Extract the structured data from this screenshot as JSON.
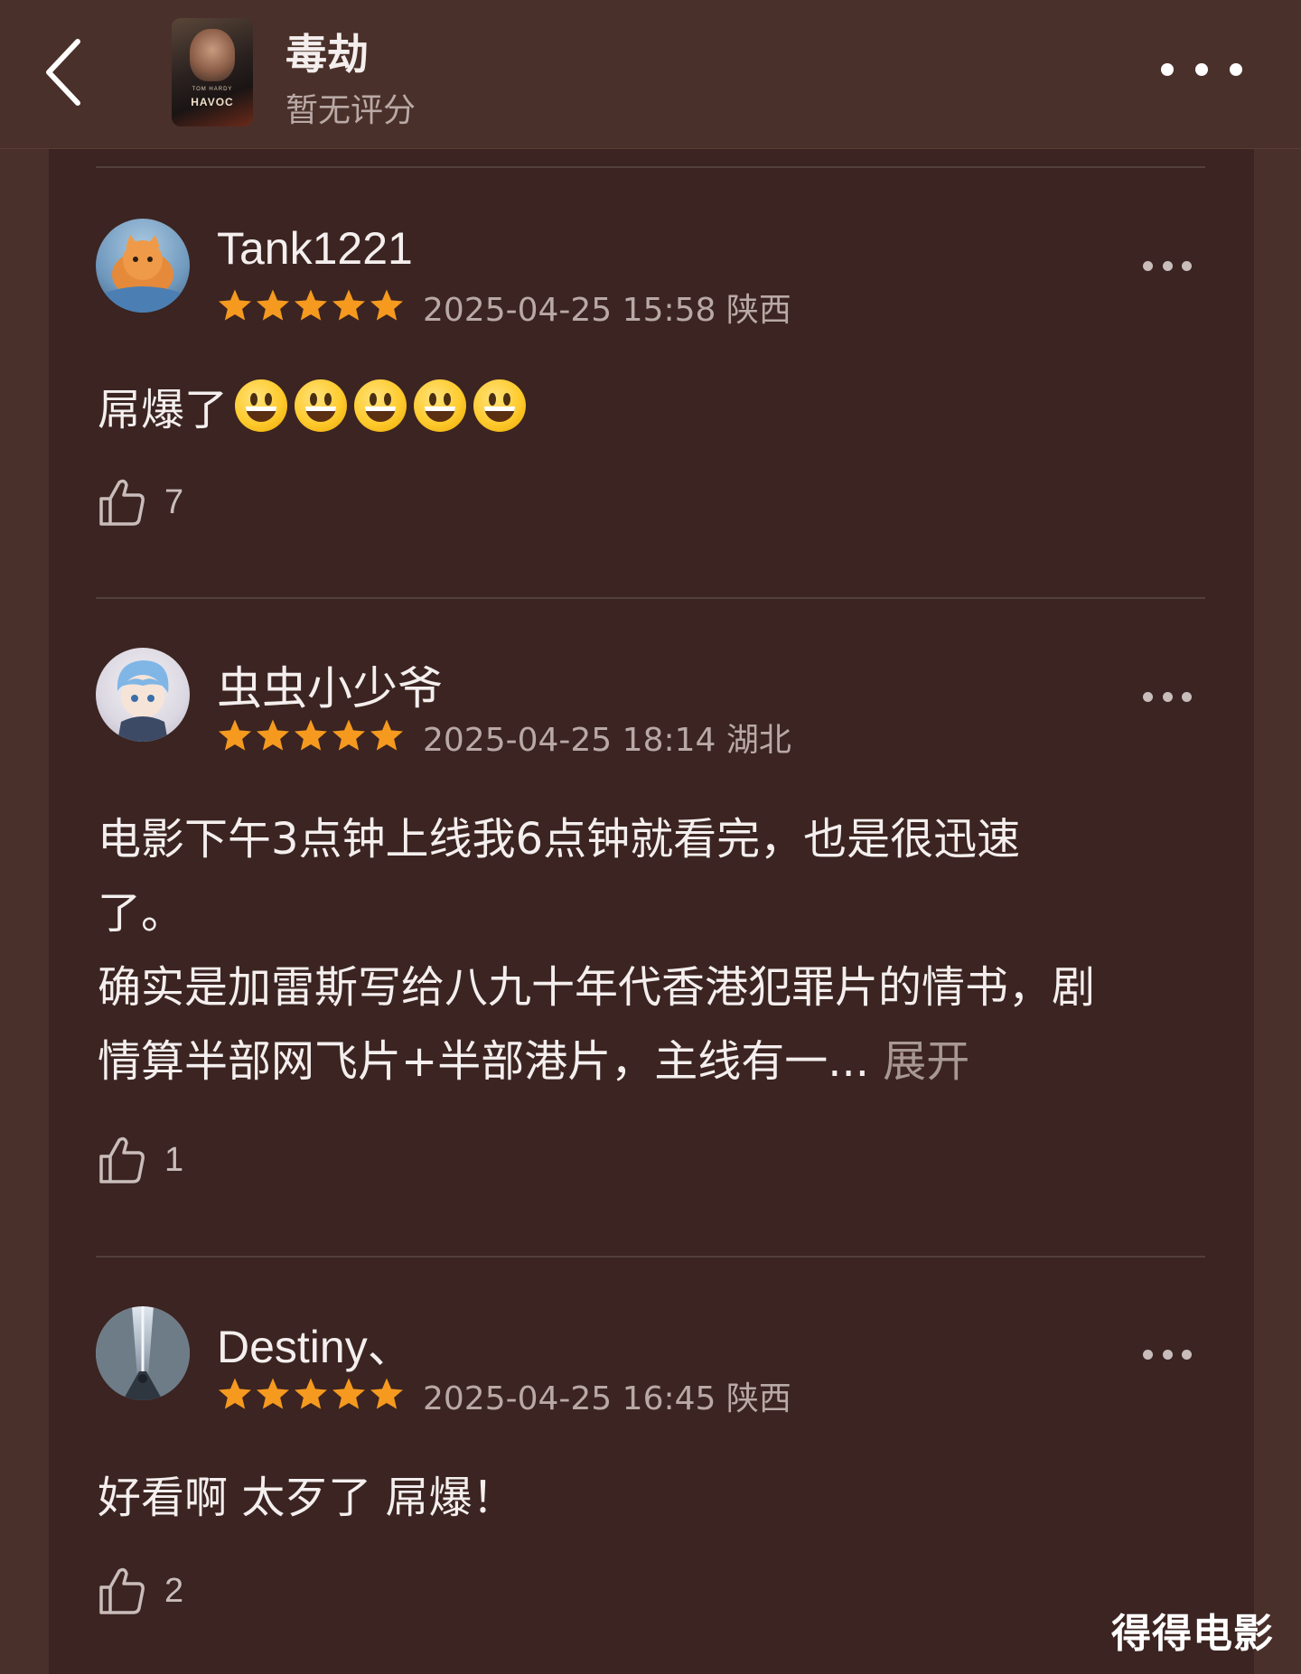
{
  "header": {
    "movie_title": "毒劫",
    "rating_text": "暂无评分",
    "poster_title": "HAVOC",
    "poster_subtitle": "TOM HARDY"
  },
  "reviews": [
    {
      "username": "Tank1221",
      "stars": 5,
      "timestamp": "2025-04-25 15:58",
      "region": "陕西",
      "content": "屌爆了",
      "emoji_count": 5,
      "likes": "7"
    },
    {
      "username": "虫虫小少爷",
      "stars": 5,
      "timestamp": "2025-04-25 18:14",
      "region": "湖北",
      "content_line1": "电影下午3点钟上线我6点钟就看完，也是很迅速",
      "content_line2": "了。",
      "content_line3": "确实是加雷斯写给八九十年代香港犯罪片的情书，剧",
      "content_line4": "情算半部网飞片+半部港片，主线有一...",
      "expand_label": "展开",
      "likes": "1"
    },
    {
      "username": "Destiny、",
      "stars": 5,
      "timestamp": "2025-04-25 16:45",
      "region": "陕西",
      "content": "好看啊 太歹了 屌爆！",
      "likes": "2"
    }
  ],
  "watermark": "得得电影",
  "colors": {
    "background": "#4a302a",
    "panel": "#3b2421",
    "star": "#f59a1f",
    "text_primary": "#f4efee",
    "text_secondary": "#b9a9a6"
  },
  "icons": [
    "back-chevron-icon",
    "more-dots-icon",
    "star-icon",
    "thumbs-up-icon",
    "grinning-emoji-icon"
  ]
}
